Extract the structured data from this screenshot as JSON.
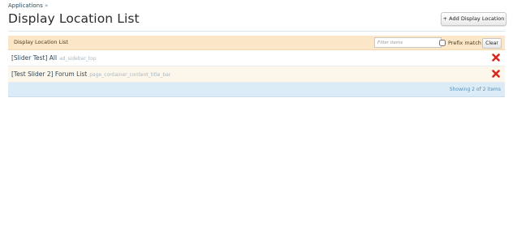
{
  "breadcrumb": {
    "items": [
      "Applications"
    ],
    "separator": "»"
  },
  "page": {
    "title": "Display Location List"
  },
  "toolbar": {
    "add_label": "+ Add Display Location"
  },
  "list": {
    "header_title": "Display Location List",
    "filter_placeholder": "Filter items",
    "prefix_match_label": "Prefix match",
    "clear_label": "Clear",
    "rows": [
      {
        "title": "[Slider Test] All",
        "code": "ad_sidebar_top"
      },
      {
        "title": "[Test Slider 2] Forum List",
        "code": "page_container_content_title_bar"
      }
    ],
    "footer": "Showing 2 of 2 items"
  },
  "colors": {
    "header_bg": "#fbe7c7",
    "footer_bg": "#dcecf7",
    "delete_red": "#d9281e"
  },
  "icons": {
    "delete": "delete-x-icon"
  }
}
